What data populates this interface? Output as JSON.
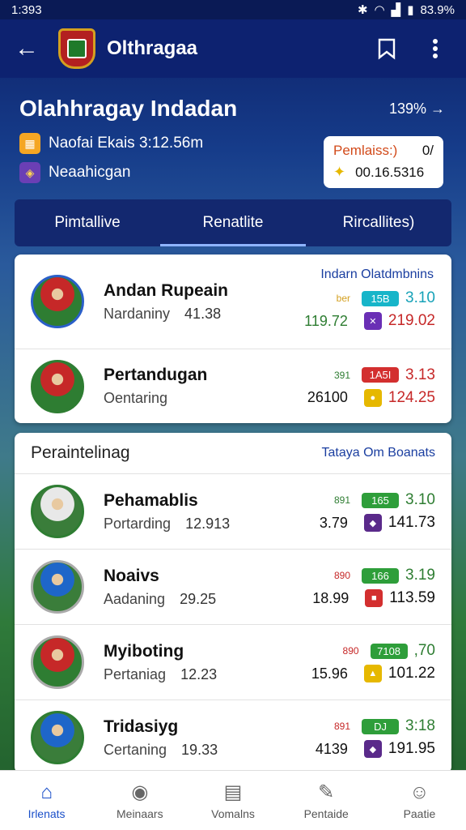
{
  "status_bar": {
    "time": "1:393",
    "battery": "83.9%"
  },
  "app_bar": {
    "title": "Olthragaa"
  },
  "hero": {
    "title": "Olahhragay Indadan",
    "link": "139% →",
    "row1": "Naofai Ekais 3:12.56m",
    "row2": "Neaahicgan",
    "badge_label": "Pemlaiss:)",
    "badge_value": "0/",
    "badge_amount": "00.16.5316"
  },
  "tabs": [
    {
      "label": "Pimtallive"
    },
    {
      "label": "Renatlite"
    },
    {
      "label": "Rircallites)"
    }
  ],
  "card1": {
    "header_right": "Indarn Olatdmbnins",
    "items": [
      {
        "name": "Andan Rupeain",
        "sub": "Nardaniny",
        "sub_num": "41.38",
        "small": "ber",
        "pill": "15B",
        "pill_color": "#17b5c9",
        "big": "3.10",
        "big_color": "#17a2b8",
        "left": "119.72",
        "sq_color": "#6a2fb5",
        "right": "219.02",
        "right_color": "#c62828"
      },
      {
        "name": "Pertandugan",
        "sub": "Oentaring",
        "sub_num": "",
        "small": "391",
        "pill": "1A5I",
        "pill_color": "#d32f2f",
        "big": "3.13",
        "big_color": "#c62828",
        "left": "26100",
        "sq_color": "#e6b800",
        "right": "124.25",
        "right_color": "#c62828"
      }
    ]
  },
  "card2": {
    "header_left": "Peraintelinag",
    "header_right": "Tataya Om Boanats",
    "items": [
      {
        "name": "Pehamablis",
        "sub": "Portarding",
        "sub_num": "12.913",
        "small": "891",
        "pill": "165",
        "pill_color": "#2e9e3a",
        "big": "3.10",
        "big_color": "#2e7d32",
        "left": "3.79",
        "sq_color": "#5a2a8a",
        "right": "141.73",
        "right_color": "#111"
      },
      {
        "name": "Noaivs",
        "sub": "Aadaning",
        "sub_num": "29.25",
        "small": "890",
        "pill": "166",
        "pill_color": "#2e9e3a",
        "big": "3.19",
        "big_color": "#2e7d32",
        "left": "18.99",
        "sq_color": "#d32f2f",
        "right": "113.59",
        "right_color": "#111"
      },
      {
        "name": "Myiboting",
        "sub": "Pertaniag",
        "sub_num": "12.23",
        "small": "890",
        "pill": "7108",
        "pill_color": "#2e9e3a",
        "big": ",70",
        "big_color": "#2e7d32",
        "left": "15.96",
        "sq_color": "#e6b800",
        "right": "101.22",
        "right_color": "#111"
      },
      {
        "name": "Tridasiyg",
        "sub": "Certaning",
        "sub_num": "19.33",
        "small": "891",
        "pill": "DJ",
        "pill_color": "#2e9e3a",
        "big": "3:18",
        "big_color": "#2e7d32",
        "left": "4139",
        "sq_color": "#5a2a8a",
        "right": "191.95",
        "right_color": "#111"
      }
    ]
  },
  "bottom_nav": [
    {
      "label": "Irlenats",
      "icon": "home-icon"
    },
    {
      "label": "Meinaars",
      "icon": "ball-icon"
    },
    {
      "label": "Vomalns",
      "icon": "news-icon"
    },
    {
      "label": "Pentaide",
      "icon": "edit-icon"
    },
    {
      "label": "Paatie",
      "icon": "people-icon"
    }
  ]
}
